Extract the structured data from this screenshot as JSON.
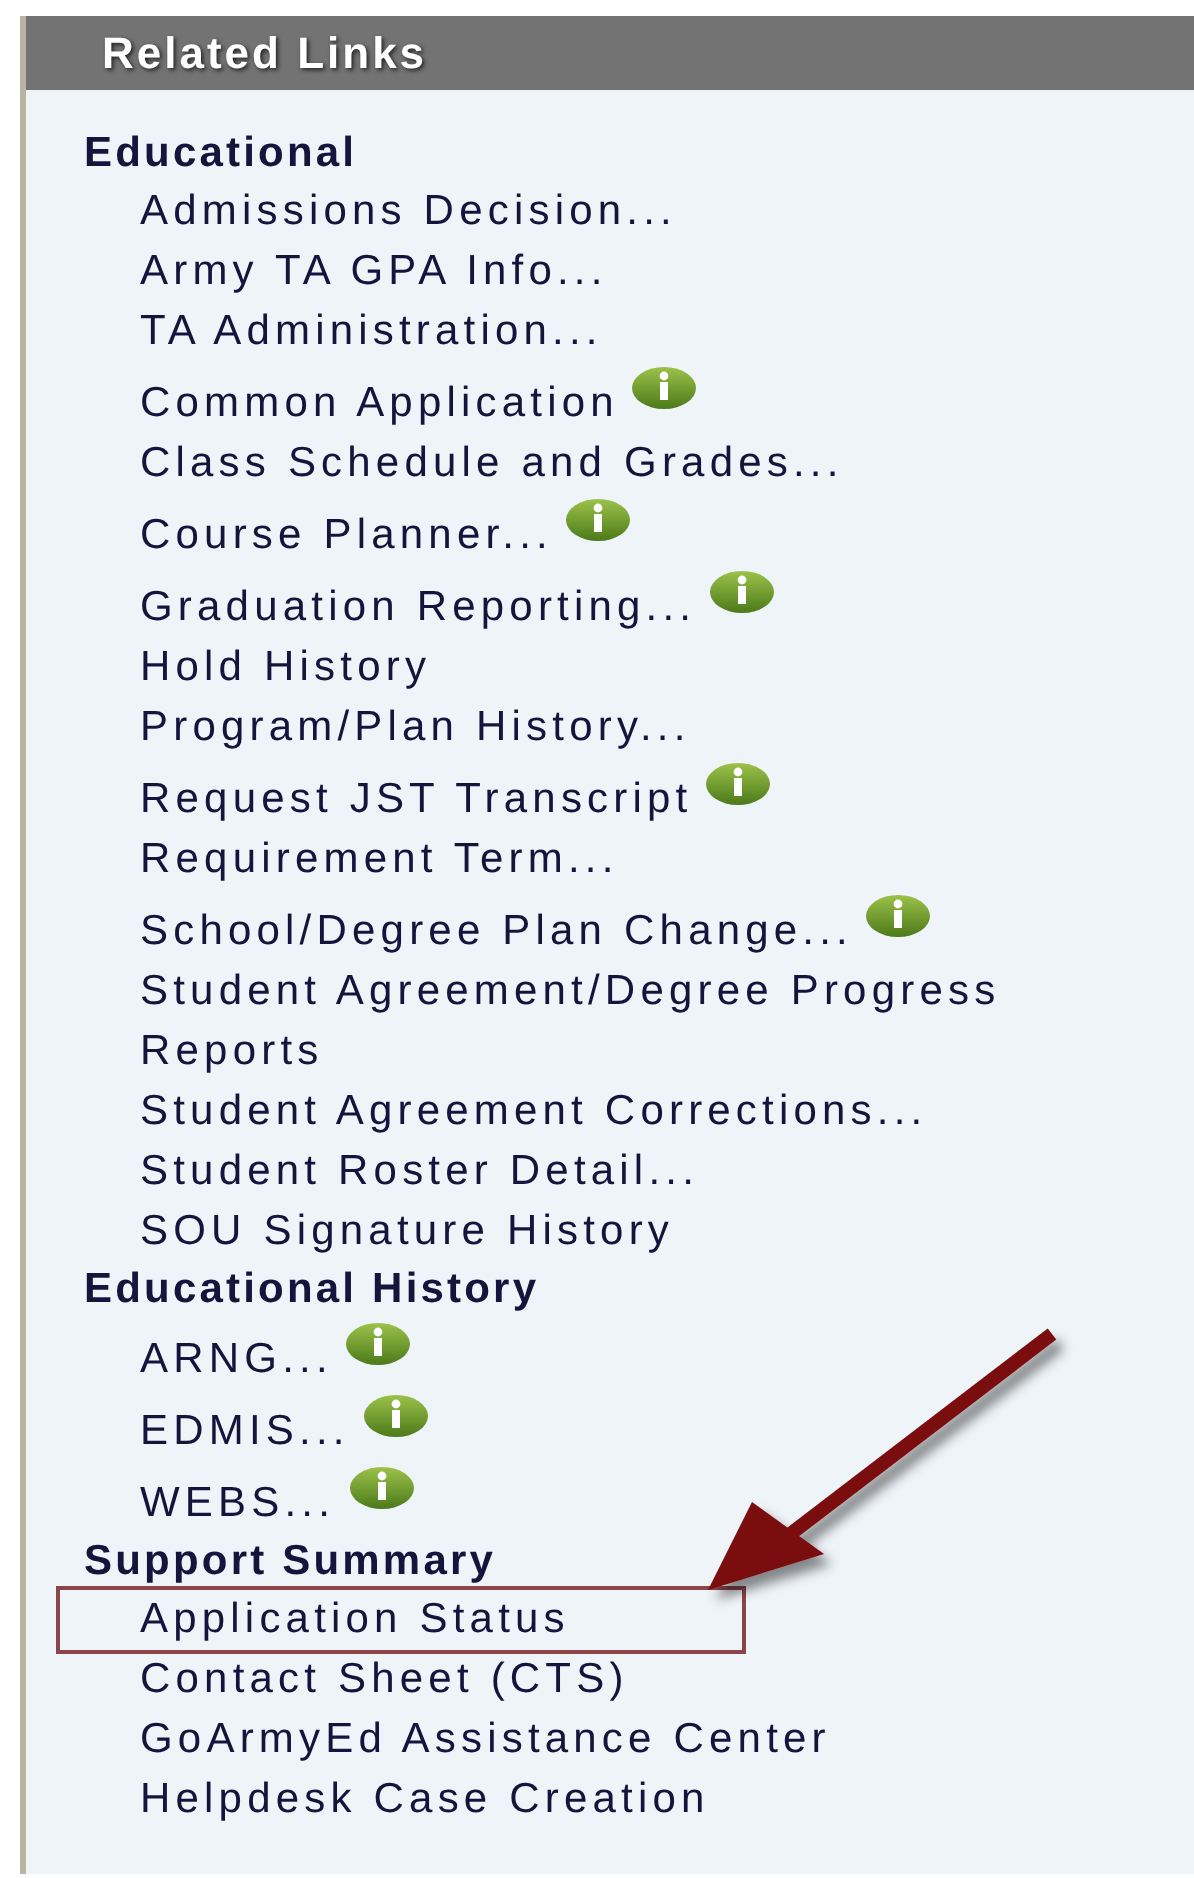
{
  "panel": {
    "title": "Related Links"
  },
  "sections": [
    {
      "heading": "Educational",
      "links": [
        {
          "label": "Admissions Decision...",
          "info": false,
          "highlighted": false
        },
        {
          "label": "Army TA GPA Info...",
          "info": false,
          "highlighted": false
        },
        {
          "label": "TA Administration...",
          "info": false,
          "highlighted": false
        },
        {
          "label": "Common Application",
          "info": true,
          "highlighted": false
        },
        {
          "label": "Class Schedule and Grades...",
          "info": false,
          "highlighted": false
        },
        {
          "label": "Course Planner...",
          "info": true,
          "highlighted": false
        },
        {
          "label": "Graduation Reporting...",
          "info": true,
          "highlighted": false
        },
        {
          "label": "Hold History",
          "info": false,
          "highlighted": false
        },
        {
          "label": "Program/Plan History...",
          "info": false,
          "highlighted": false
        },
        {
          "label": "Request JST Transcript",
          "info": true,
          "highlighted": false
        },
        {
          "label": "Requirement Term...",
          "info": false,
          "highlighted": false
        },
        {
          "label": "School/Degree Plan Change...",
          "info": true,
          "highlighted": false
        },
        {
          "label": "Student Agreement/Degree Progress Reports",
          "info": false,
          "highlighted": false
        },
        {
          "label": "Student Agreement Corrections...",
          "info": false,
          "highlighted": false
        },
        {
          "label": "Student Roster Detail...",
          "info": false,
          "highlighted": false
        },
        {
          "label": "SOU Signature History",
          "info": false,
          "highlighted": false
        }
      ]
    },
    {
      "heading": "Educational History",
      "links": [
        {
          "label": "ARNG...",
          "info": true,
          "highlighted": false
        },
        {
          "label": "EDMIS...",
          "info": true,
          "highlighted": false
        },
        {
          "label": "WEBS...",
          "info": true,
          "highlighted": false
        }
      ]
    },
    {
      "heading": "Support Summary",
      "links": [
        {
          "label": "Application Status",
          "info": false,
          "highlighted": true
        },
        {
          "label": "Contact Sheet (CTS)",
          "info": false,
          "highlighted": false
        },
        {
          "label": "GoArmyEd Assistance Center",
          "info": false,
          "highlighted": false
        },
        {
          "label": "Helpdesk Case Creation",
          "info": false,
          "highlighted": false
        }
      ]
    }
  ]
}
